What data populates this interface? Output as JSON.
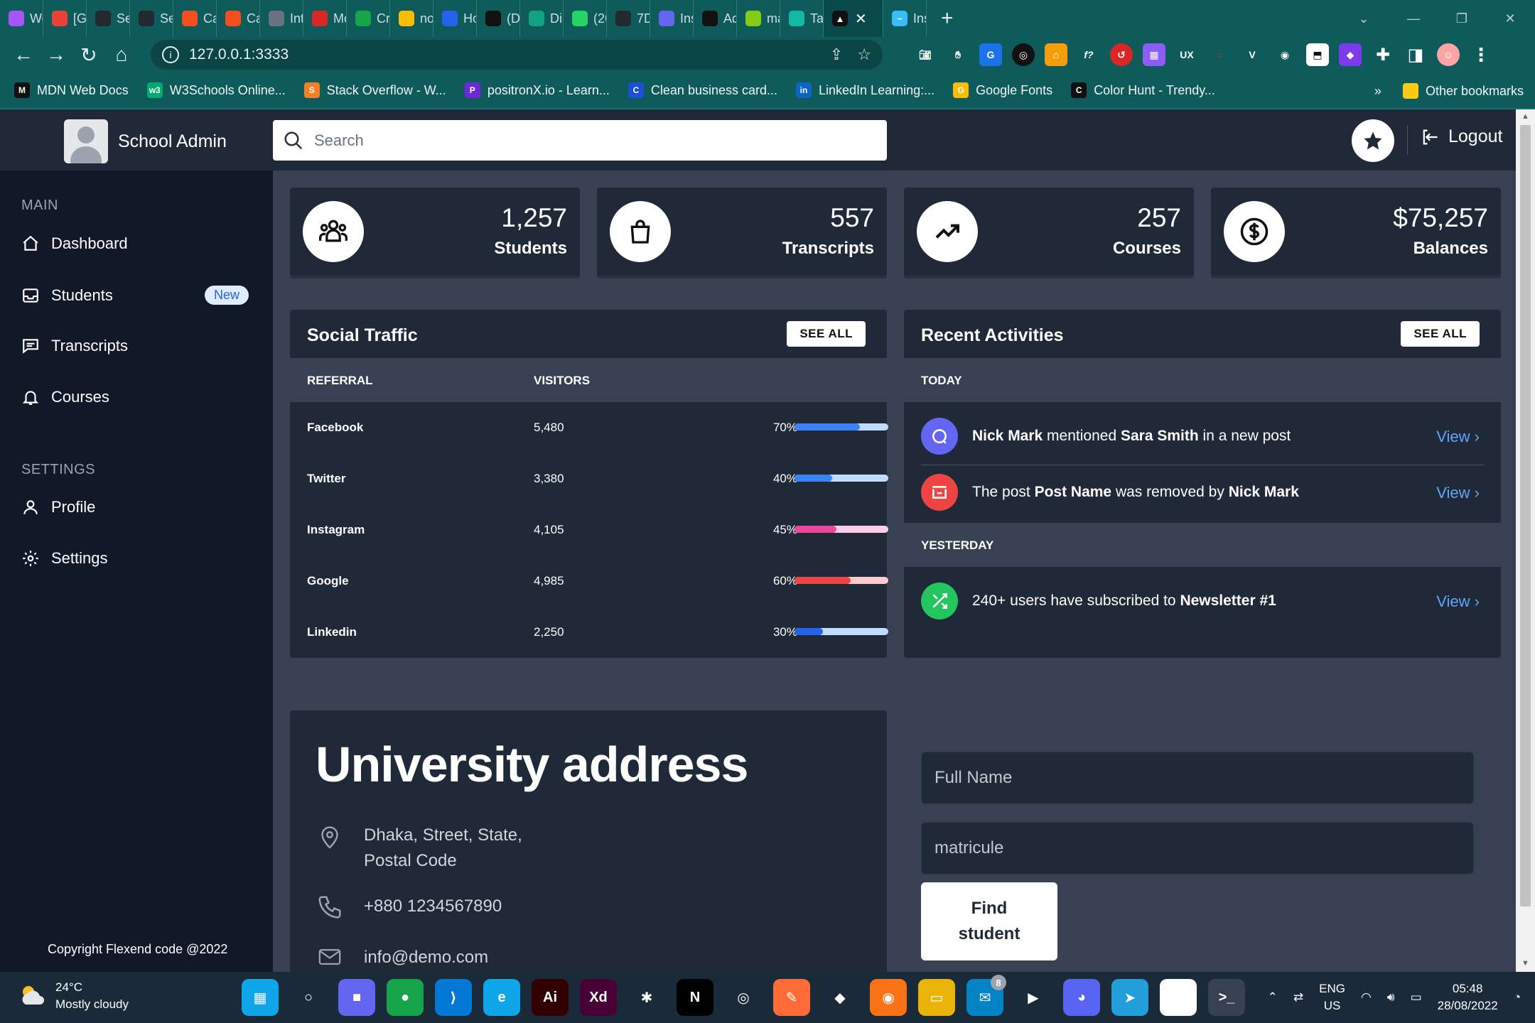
{
  "browser": {
    "tabs": [
      {
        "label": "We",
        "color": "#a855f7"
      },
      {
        "label": "[Gi",
        "color": "#ea4335"
      },
      {
        "label": "Se",
        "color": "#24292f"
      },
      {
        "label": "Se",
        "color": "#24292f"
      },
      {
        "label": "Ca",
        "color": "#f24e1e"
      },
      {
        "label": "Ca",
        "color": "#f24e1e"
      },
      {
        "label": "Int",
        "color": "#6b7280"
      },
      {
        "label": "Mc",
        "color": "#dc2626"
      },
      {
        "label": "Cre",
        "color": "#16a34a"
      },
      {
        "label": "no",
        "color": "#fbbc04"
      },
      {
        "label": "Ho",
        "color": "#2563eb"
      },
      {
        "label": "(D",
        "color": "#111111"
      },
      {
        "label": "Dis",
        "color": "#10a37f"
      },
      {
        "label": "(26",
        "color": "#25d366"
      },
      {
        "label": "7D",
        "color": "#24292f"
      },
      {
        "label": "Ins",
        "color": "#6366f1"
      },
      {
        "label": "Ad",
        "color": "#111111"
      },
      {
        "label": "ma",
        "color": "#84cc16"
      },
      {
        "label": "Tai",
        "color": "#14b8a6"
      }
    ],
    "active_tab": {
      "label": "",
      "color": "#111111"
    },
    "last_tab": {
      "label": "Ins",
      "color": "#38bdf8"
    },
    "url": "127.0.0.1:3333",
    "bookmarks": [
      {
        "label": "MDN Web Docs",
        "icon": "M",
        "color": "#111111"
      },
      {
        "label": "W3Schools Online...",
        "icon": "w3",
        "color": "#04aa6d"
      },
      {
        "label": "Stack Overflow - W...",
        "icon": "S",
        "color": "#f48024"
      },
      {
        "label": "positronX.io - Learn...",
        "icon": "P",
        "color": "#6d28d9"
      },
      {
        "label": "Clean business card...",
        "icon": "C",
        "color": "#1d4ed8"
      },
      {
        "label": "LinkedIn Learning:...",
        "icon": "in",
        "color": "#0a66c2"
      },
      {
        "label": "Google Fonts",
        "icon": "G",
        "color": "#fbbc04"
      },
      {
        "label": "Color Hunt - Trendy...",
        "icon": "C",
        "color": "#111111"
      }
    ],
    "more_bookmarks": "»",
    "other_bookmarks": "Other bookmarks"
  },
  "app": {
    "brand": "School Admin",
    "search_placeholder": "Search",
    "logout": "Logout",
    "sidebar": {
      "section_main": "MAIN",
      "section_settings": "SETTINGS",
      "items": [
        {
          "label": "Dashboard"
        },
        {
          "label": "Students",
          "badge": "New"
        },
        {
          "label": "Transcripts"
        },
        {
          "label": "Courses"
        },
        {
          "label": "Profile"
        },
        {
          "label": "Settings"
        }
      ],
      "copyright": "Copyright Flexend code @2022"
    },
    "stats": [
      {
        "value": "1,257",
        "label": "Students",
        "icon": "users-icon"
      },
      {
        "value": "557",
        "label": "Transcripts",
        "icon": "shopping-bag-icon"
      },
      {
        "value": "257",
        "label": "Courses",
        "icon": "trending-up-icon"
      },
      {
        "value": "$75,257",
        "label": "Balances",
        "icon": "dollar-icon"
      }
    ],
    "social": {
      "title": "Social Traffic",
      "see_all": "SEE ALL",
      "col_referral": "REFERRAL",
      "col_visitors": "VISITORS",
      "rows": [
        {
          "referral": "Facebook",
          "visitors": "5,480",
          "percent": "70%",
          "value": 0.7,
          "color": "#3b82f6",
          "track": "#bfdbfe"
        },
        {
          "referral": "Twitter",
          "visitors": "3,380",
          "percent": "40%",
          "value": 0.4,
          "color": "#3b82f6",
          "track": "#bfdbfe"
        },
        {
          "referral": "Instagram",
          "visitors": "4,105",
          "percent": "45%",
          "value": 0.45,
          "color": "#ec4899",
          "track": "#fbcfe8"
        },
        {
          "referral": "Google",
          "visitors": "4,985",
          "percent": "60%",
          "value": 0.6,
          "color": "#ef4444",
          "track": "#fecaca"
        },
        {
          "referral": "Linkedin",
          "visitors": "2,250",
          "percent": "30%",
          "value": 0.3,
          "color": "#2563eb",
          "track": "#bfdbfe"
        }
      ]
    },
    "activities": {
      "title": "Recent Activities",
      "see_all": "SEE ALL",
      "today": "TODAY",
      "yesterday": "YESTERDAY",
      "view": "View",
      "items": [
        {
          "parts": [
            {
              "t": "Nick Mark",
              "b": true
            },
            {
              "t": " mentioned "
            },
            {
              "t": "Sara Smith",
              "b": true
            },
            {
              "t": " in a new post"
            }
          ],
          "color": "#6366f1"
        },
        {
          "parts": [
            {
              "t": "The post "
            },
            {
              "t": "Post Name",
              "b": true
            },
            {
              "t": " was removed by "
            },
            {
              "t": "Nick Mark",
              "b": true
            }
          ],
          "color": "#ef4444"
        },
        {
          "parts": [
            {
              "t": "240+ users have subscribed to "
            },
            {
              "t": "Newsletter #1",
              "b": true
            }
          ],
          "color": "#22c55e"
        }
      ]
    },
    "address": {
      "title": "University address",
      "location_line1": "Dhaka, Street, State,",
      "location_line2": "Postal Code",
      "phone": "+880 1234567890",
      "email": "info@demo.com"
    },
    "form": {
      "name_placeholder": "Full Name",
      "matricule_placeholder": "matricule",
      "button_line1": "Find",
      "button_line2": "student"
    }
  },
  "taskbar": {
    "temperature": "24°C",
    "weather": "Mostly cloudy",
    "lang_line1": "ENG",
    "lang_line2": "US",
    "time": "05:48",
    "date": "28/08/2022",
    "mail_badge": "8",
    "apps": [
      {
        "name": "start-icon",
        "color": "#0ea5e9",
        "glyph": "▦"
      },
      {
        "name": "search-icon",
        "color": "transparent",
        "glyph": "○"
      },
      {
        "name": "chat-icon",
        "color": "#6366f1",
        "glyph": "■"
      },
      {
        "name": "chrome-icon",
        "color": "#16a34a",
        "glyph": "●"
      },
      {
        "name": "vscode-icon",
        "color": "#0078d4",
        "glyph": "⟩"
      },
      {
        "name": "edge-icon",
        "color": "#0ea5e9",
        "glyph": "e"
      },
      {
        "name": "illustrator-icon",
        "color": "#330000",
        "glyph": "Ai"
      },
      {
        "name": "xd-icon",
        "color": "#470137",
        "glyph": "Xd"
      },
      {
        "name": "slack-icon",
        "color": "transparent",
        "glyph": "✱"
      },
      {
        "name": "netflix-icon",
        "color": "#000000",
        "glyph": "N"
      },
      {
        "name": "obs-icon",
        "color": "transparent",
        "glyph": "◎"
      },
      {
        "name": "postman-icon",
        "color": "#ff6c37",
        "glyph": "✎"
      },
      {
        "name": "git-icon",
        "color": "transparent",
        "glyph": "◆"
      },
      {
        "name": "firefox-icon",
        "color": "#f97316",
        "glyph": "◉"
      },
      {
        "name": "folder-icon",
        "color": "#eab308",
        "glyph": "▭"
      },
      {
        "name": "mail-icon",
        "color": "#0284c7",
        "glyph": "✉"
      },
      {
        "name": "media-icon",
        "color": "transparent",
        "glyph": "▶"
      },
      {
        "name": "discord-icon",
        "color": "#5865f2",
        "glyph": "◕"
      },
      {
        "name": "telegram-icon",
        "color": "#229ed9",
        "glyph": "➤"
      },
      {
        "name": "word-icon",
        "color": "#ffffff",
        "glyph": "W"
      },
      {
        "name": "terminal-icon",
        "color": "#374151",
        "glyph": ">_"
      }
    ]
  }
}
